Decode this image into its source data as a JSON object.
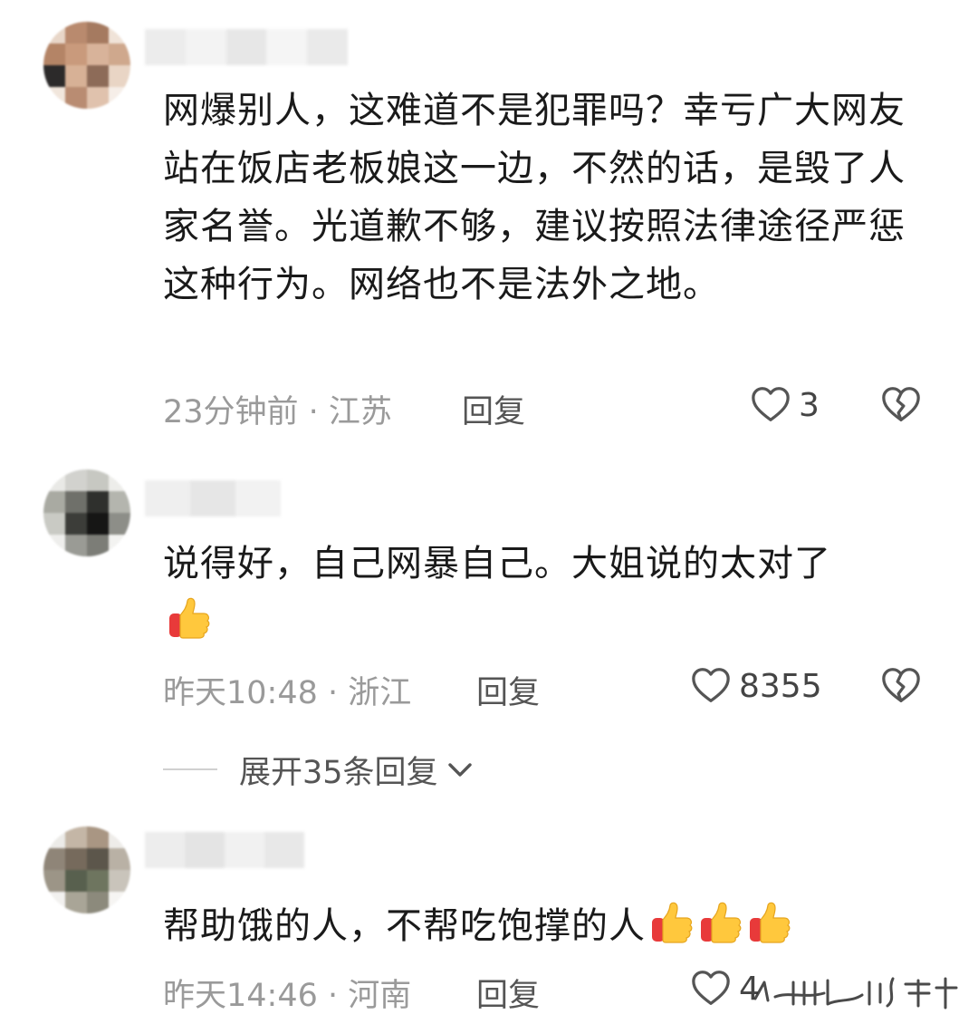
{
  "comments": [
    {
      "text": "网爆别人，这难道不是犯罪吗？幸亏广大网友站在饭店老板娘这一边，不然的话，是毁了人家名誉。光道歉不够，建议按照法律途径严惩这种行为。网络也不是法外之地。",
      "time_location": "23分钟前 · 江苏",
      "reply_label": "回复",
      "like_count": "3"
    },
    {
      "text": "说得好，自己网暴自己。大姐说的太对了",
      "emoji": "thumbs-up",
      "time_location": "昨天10:48 · 浙江",
      "reply_label": "回复",
      "like_count": "8355",
      "expand_replies_label": "展开35条回复"
    },
    {
      "text": "帮助饿的人，不帮吃饱撑的人",
      "emoji_count": 3,
      "time_location": "昨天14:46 · 河南",
      "reply_label": "回复",
      "like_count": "4"
    }
  ],
  "icons": {
    "like": "heart-outline-icon",
    "dislike": "broken-heart-icon",
    "expand": "chevron-down-icon",
    "emoji": "thumbs-up-icon"
  },
  "colors": {
    "meta_text": "#9a9a9a",
    "body_text": "#1a1a1a",
    "icon_stroke": "#555555",
    "thumb_yellow": "#ffc83d",
    "thumb_red": "#e83a3a"
  }
}
